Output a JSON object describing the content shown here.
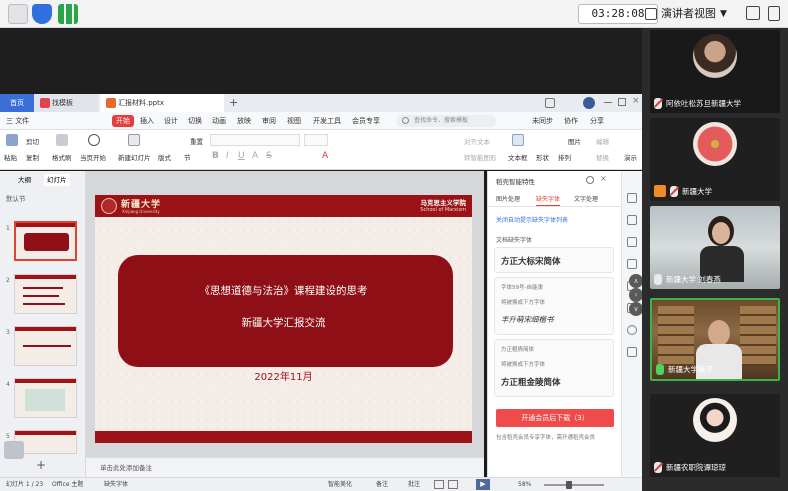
{
  "meeting": {
    "clock": "03:28:08",
    "view_mode": "演讲者视图"
  },
  "wps": {
    "tabs": {
      "home": "首页",
      "docer": "找模板",
      "file": "汇报材料.pptx"
    },
    "menu": {
      "file": "三 文件",
      "start": "开始",
      "insert": "插入",
      "design": "设计",
      "transition": "切换",
      "animation": "动画",
      "slideshow": "放映",
      "review": "审阅",
      "view": "视图",
      "dev": "开发工具",
      "member": "会员专享",
      "search_placeholder": "查找命令、搜索模板",
      "sync": "未同步",
      "collab": "协作",
      "share": "分享"
    },
    "ribbon": {
      "paste": "粘贴",
      "cut": "剪切",
      "copy": "复制",
      "format_painter": "格式刷",
      "play_from": "当页开始",
      "new_slide": "新建幻灯片",
      "layout": "版式",
      "section": "节",
      "reset": "重置",
      "textbox": "文本框",
      "shape": "形状",
      "arrange": "排列",
      "picture": "图片",
      "fill": "填充",
      "outline": "轮廓",
      "align_text": "对齐文本",
      "convert_smartart": "转智能图形",
      "edit": "编辑",
      "replace": "替换",
      "slideshow_short": "演示"
    },
    "left_panel": {
      "tab_outline": "大纲",
      "tab_slides": "幻灯片",
      "section": "默认节",
      "thumb_numbers": [
        "1",
        "2",
        "3",
        "4",
        "5"
      ]
    },
    "slide": {
      "logo_text": "新疆大学",
      "logo_sub": "Xinjiang University",
      "school": "马克思主义学院",
      "school_en": "School of Marxism",
      "title_line1": "《思想道德与法治》课程建设的思考",
      "title_line2": "新疆大学汇报交流",
      "date": "2022年11月"
    },
    "notes_placeholder": "单击此处添加备注",
    "font_panel": {
      "title": "稻壳智能特性",
      "tabs": [
        "图片处理",
        "缺失字体",
        "文字处理"
      ],
      "link": "关闭自动提示缺失字体列表",
      "label_missing": "文档缺失字体",
      "font1": "方正大标宋简体",
      "label2": "字体59号-自能隶",
      "replaced_with": "将被换成下方字体",
      "font2": "丰升萌宋细楷书",
      "label3": "方正粗倩简体",
      "font3": "方正粗金陵简体",
      "download_btn": "开通会员后下载（3）",
      "member_note": "包含稻壳会员专享字体，需开通稻壳会员"
    },
    "status": {
      "slide_count": "幻灯片 1 / 23",
      "theme": "Office 主题",
      "missing_font": "缺失字体",
      "smart_beautify": "智能美化",
      "notes": "备注",
      "comments": "批注",
      "zoom": "58%"
    }
  },
  "participants": [
    {
      "name": "阿依吐松苏旦新疆大学",
      "muted": true
    },
    {
      "name": "新疆大学",
      "muted": true
    },
    {
      "name": "新疆大学 刘春燕",
      "muted": false
    },
    {
      "name": "新疆大学董平",
      "muted": false
    },
    {
      "name": "新疆农职院谭琼琼",
      "muted": true
    }
  ]
}
